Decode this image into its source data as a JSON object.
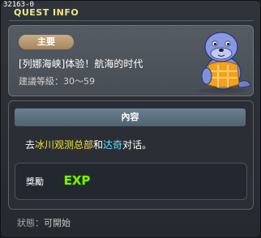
{
  "window": {
    "quest_id": "32163-0",
    "title": "QUEST INFO"
  },
  "quest": {
    "badge": "主要",
    "name": "[列娜海峡]体验！航海的时代",
    "level_label": "建議等級：30～59"
  },
  "content": {
    "header": "內容",
    "desc_prefix": "去",
    "desc_place": "冰川观测总部",
    "desc_mid": "和",
    "desc_npc": "达奇",
    "desc_suffix": "对话。"
  },
  "reward": {
    "label": "獎勵",
    "exp_text": "EXP"
  },
  "status": {
    "label": "狀態：",
    "value": "可開始"
  },
  "icons": {
    "mascot": "seal-mascot-icon",
    "exp": "exp-reward-icon"
  },
  "colors": {
    "title": "#f0e68c",
    "badge": "#b89a74",
    "place_highlight": "#f0e040",
    "npc_highlight": "#66e0ff",
    "exp_green": "#7ef000"
  }
}
